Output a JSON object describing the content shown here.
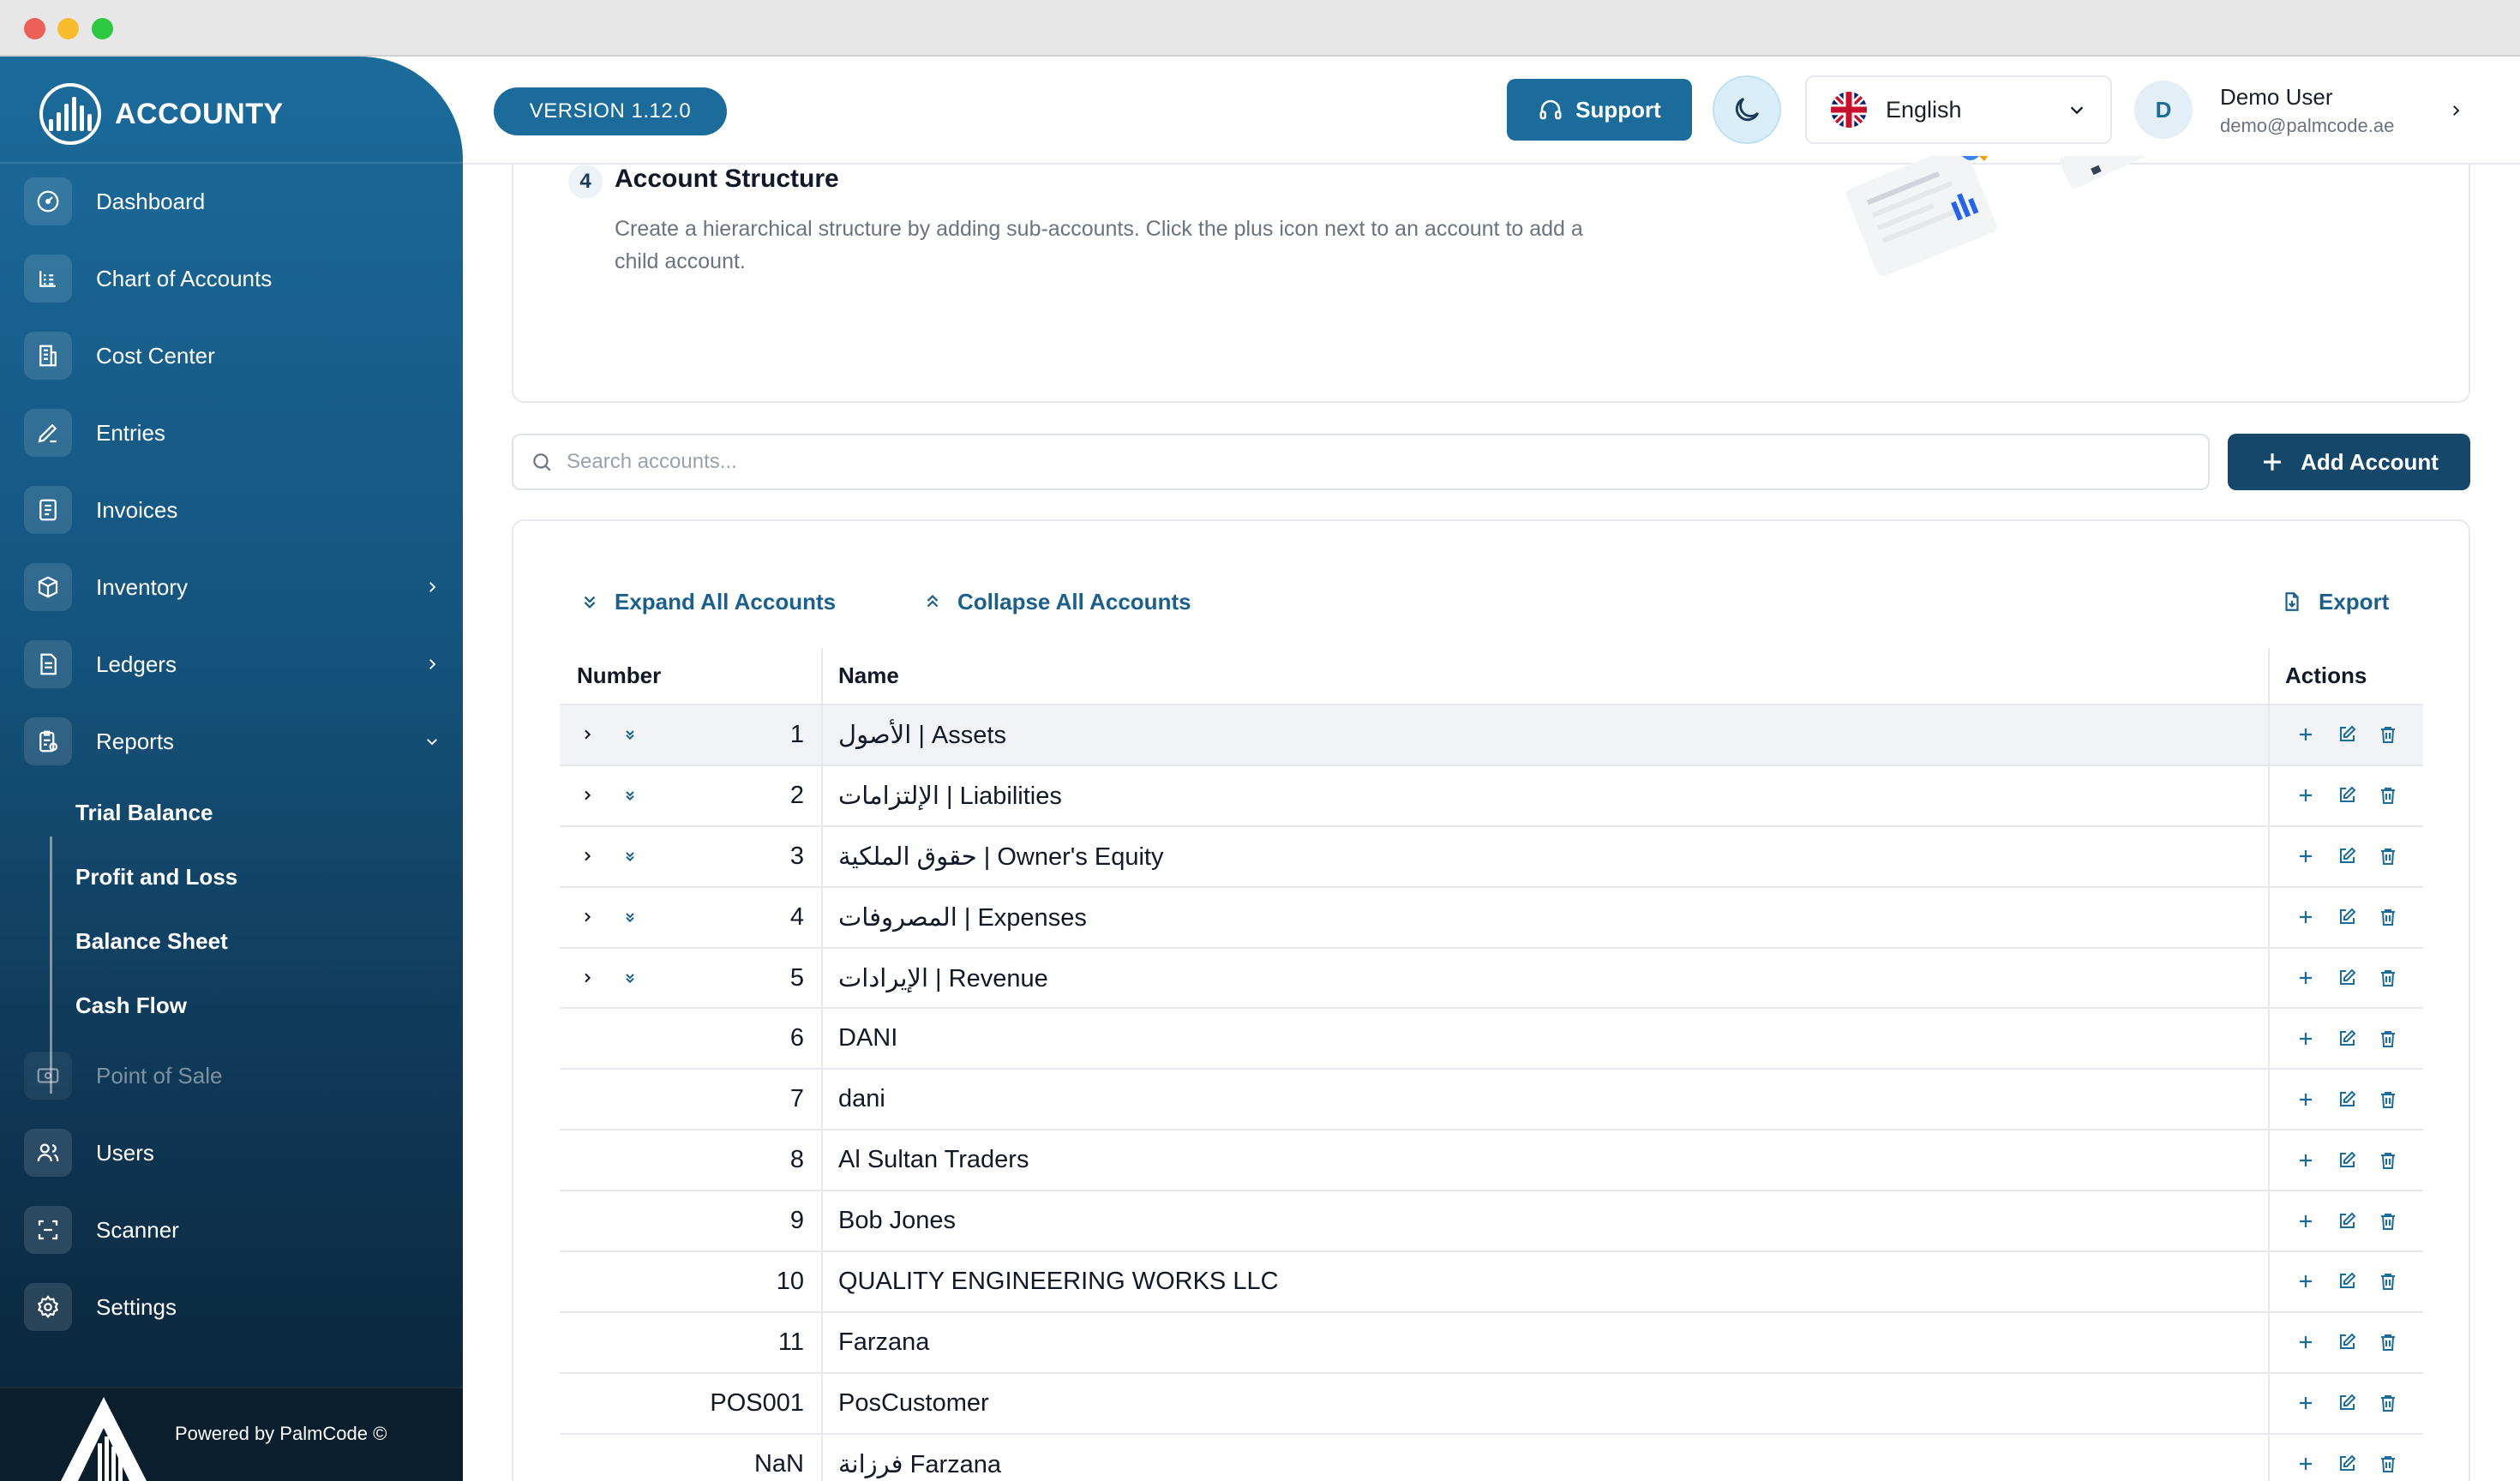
{
  "app": {
    "brand_name": "ACCOUNTY",
    "version": "VERSION 1.12.0",
    "footer": "Powered by PalmCode ©"
  },
  "header": {
    "support_label": "Support",
    "language": "English",
    "user_initial": "D",
    "user_name": "Demo User",
    "user_email": "demo@palmcode.ae"
  },
  "sidebar": {
    "items": [
      {
        "label": "Dashboard",
        "icon": "dashboard-icon"
      },
      {
        "label": "Chart of Accounts",
        "icon": "chart-icon"
      },
      {
        "label": "Cost Center",
        "icon": "building-icon"
      },
      {
        "label": "Entries",
        "icon": "pen-icon"
      },
      {
        "label": "Invoices",
        "icon": "invoice-icon"
      },
      {
        "label": "Inventory",
        "icon": "box-icon"
      },
      {
        "label": "Ledgers",
        "icon": "ledger-icon"
      },
      {
        "label": "Reports",
        "icon": "report-icon"
      },
      {
        "label": "Point of Sale",
        "icon": "cash-icon"
      },
      {
        "label": "Users",
        "icon": "users-icon"
      },
      {
        "label": "Scanner",
        "icon": "scanner-icon"
      },
      {
        "label": "Settings",
        "icon": "gear-icon"
      }
    ],
    "report_subitems": [
      "Trial Balance",
      "Profit and Loss",
      "Balance Sheet",
      "Cash Flow"
    ]
  },
  "info": {
    "step_number": "4",
    "title": "Account Structure",
    "description": "Create a hierarchical structure by adding sub-accounts. Click the plus icon next to an account to add a child account."
  },
  "search": {
    "placeholder": "Search accounts...",
    "value": ""
  },
  "toolbar": {
    "add_account": "Add Account",
    "expand_all": "Expand All Accounts",
    "collapse_all": "Collapse All Accounts",
    "export": "Export"
  },
  "table": {
    "headers": {
      "number": "Number",
      "name": "Name",
      "actions": "Actions"
    },
    "rows": [
      {
        "number": "1",
        "name": "الأصول | Assets"
      },
      {
        "number": "2",
        "name": "الإلتزامات | Liabilities"
      },
      {
        "number": "3",
        "name": "حقوق الملكية | Owner's Equity"
      },
      {
        "number": "4",
        "name": "المصروفات | Expenses"
      },
      {
        "number": "5",
        "name": "الإيرادات | Revenue"
      },
      {
        "number": "6",
        "name": "DANI"
      },
      {
        "number": "7",
        "name": "dani"
      },
      {
        "number": "8",
        "name": "Al Sultan Traders"
      },
      {
        "number": "9",
        "name": "Bob Jones"
      },
      {
        "number": "10",
        "name": "QUALITY ENGINEERING WORKS LLC"
      },
      {
        "number": "11",
        "name": "Farzana"
      },
      {
        "number": "POS001",
        "name": "PosCustomer"
      },
      {
        "number": "NaN",
        "name": "فرزانة Farzana"
      }
    ]
  },
  "colors": {
    "primary": "#1b6b9b",
    "dark_primary": "#15476b",
    "sidebar_bottom": "#0a2336",
    "action_icon": "#1b6b9b"
  }
}
